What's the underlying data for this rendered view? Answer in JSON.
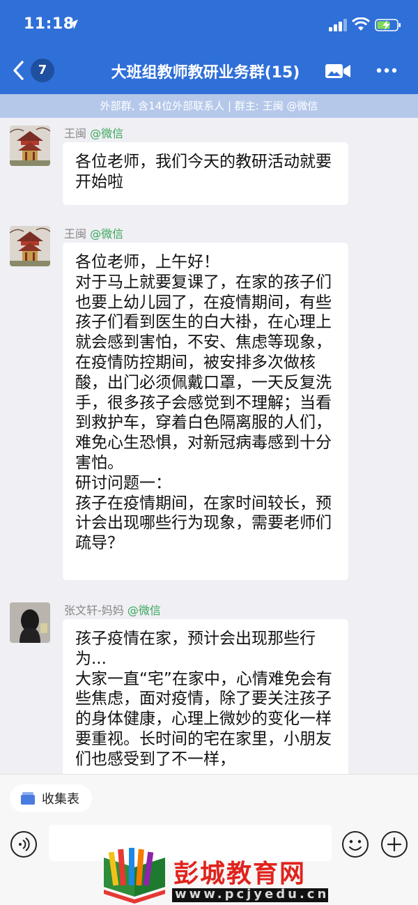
{
  "status_bar": {
    "time": "11:18"
  },
  "header": {
    "unread_count": "7",
    "title": "大班组教师教研业务群(15)",
    "subtitle": "外部群, 含14位外部联系人 | 群主: 王闽 @微信"
  },
  "messages": [
    {
      "sender": "王闽",
      "source": "@微信",
      "text": "各位老师，我们今天的教研活动就要开始啦"
    },
    {
      "sender": "王闽",
      "source": "@微信",
      "text": "各位老师，上午好！\n对于马上就要复课了，在家的孩子们也要上幼儿园了，在疫情期间，有些孩子们看到医生的白大褂，在心理上就会感到害怕，不安、焦虑等现象，在疫情防控期间，被安排多次做核酸，出门必须佩戴口罩，一天反复洗手，很多孩子会感觉到不理解；当看到救护车，穿着白色隔离服的人们，难免心生恐惧，对新冠病毒感到十分害怕。\n研讨问题一：\n孩子在疫情期间，在家时间较长，预计会出现哪些行为现象，需要老师们疏导？"
    },
    {
      "sender": "张文轩-妈妈",
      "source": "@微信",
      "text": "孩子疫情在家，预计会出现那些行为...\n大家一直“宅”在家中，心情难免会有些焦虑，面对疫情，除了要关注孩子的身体健康，心理上微妙的变化一样要重视。长时间的宅在家里，小朋友们也感受到了不一样，"
    }
  ],
  "toolbar": {
    "collect_label": "收集表",
    "input_value": ""
  },
  "watermark": {
    "name": "彭城教育网",
    "url": "www.pcjyedu.cn"
  },
  "icons": {
    "back": "chevron-left-icon",
    "video": "video-call-icon",
    "more": "more-dots-icon",
    "voice": "voice-input-icon",
    "emoji": "emoji-icon",
    "plus": "plus-icon"
  },
  "colors": {
    "header_bg": "#2f6fd8",
    "subbar_bg": "#b5c8ea",
    "wechat_green": "#3aa65b",
    "watermark_red": "#e0221c"
  }
}
